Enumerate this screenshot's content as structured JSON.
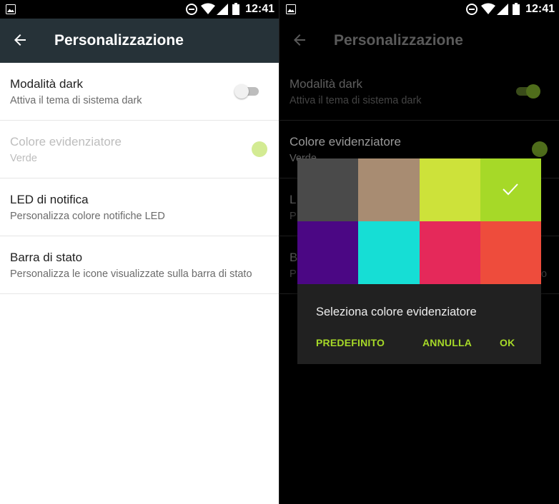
{
  "status_bar": {
    "time": "12:41"
  },
  "colors": {
    "appbar_light": "#263238",
    "accent": "#a4d62a",
    "accent_disabled": "#d3eb93"
  },
  "light_screen": {
    "title": "Personalizzazione",
    "dark_mode": {
      "title": "Modalità dark",
      "subtitle": "Attiva il tema di sistema dark",
      "enabled": false
    },
    "accent_color": {
      "title": "Colore evidenziatore",
      "subtitle": "Verde",
      "disabled": true
    },
    "led": {
      "title": "LED di notifica",
      "subtitle": "Personalizza colore notifiche LED"
    },
    "status_bar_setting": {
      "title": "Barra di stato",
      "subtitle": "Personalizza le icone visualizzate sulla barra di stato"
    }
  },
  "dark_screen": {
    "title": "Personalizzazione",
    "dark_mode": {
      "title": "Modalità dark",
      "subtitle": "Attiva il tema di sistema dark",
      "enabled": true
    },
    "accent_color": {
      "title": "Colore evidenziatore",
      "subtitle": "Verde"
    },
    "led": {
      "title": "L",
      "subtitle": "P"
    },
    "status_bar_setting": {
      "title": "B",
      "subtitle": "P",
      "subtitle_tail": "o"
    }
  },
  "dialog": {
    "title": "Seleziona colore evidenziatore",
    "swatches": [
      {
        "color": "#4a4a4a",
        "selected": false
      },
      {
        "color": "#a88c72",
        "selected": false
      },
      {
        "color": "#cde23a",
        "selected": false
      },
      {
        "color": "#a6d928",
        "selected": true
      },
      {
        "color": "#4b0784",
        "selected": false
      },
      {
        "color": "#16ded5",
        "selected": false
      },
      {
        "color": "#e5295a",
        "selected": false
      },
      {
        "color": "#ee4c3c",
        "selected": false
      }
    ],
    "buttons": {
      "default": "PREDEFINITO",
      "cancel": "ANNULLA",
      "ok": "OK"
    }
  }
}
